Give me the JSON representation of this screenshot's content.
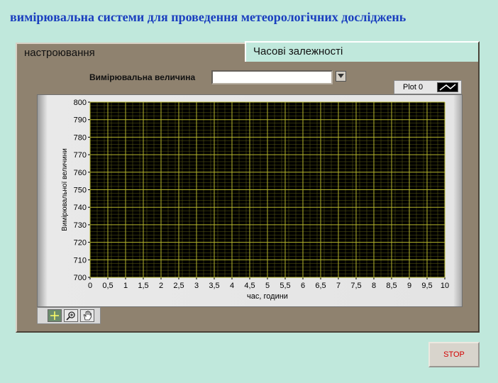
{
  "app": {
    "title": "вимірювальна системи для проведення метеорологічних досліджень"
  },
  "tabs": [
    {
      "label": "настроювання",
      "active": false
    },
    {
      "label": "Часові залежності",
      "active": true
    }
  ],
  "quantity": {
    "label": "Вимірювальна величина",
    "value": ""
  },
  "legend": {
    "plot_name": "Plot 0"
  },
  "stop_button": {
    "label": "STOP"
  },
  "colors": {
    "background": "#c0e8dc",
    "panel": "#8f826f",
    "plot_area": "#000000",
    "grid": "#b5b52c",
    "title_blue": "#1a3fbf",
    "stop_red": "#d40000"
  },
  "chart_data": {
    "type": "line",
    "xlabel": "час, години",
    "ylabel": "Вимірювальної величини",
    "xlim": [
      0,
      10
    ],
    "ylim": [
      700,
      800
    ],
    "x_ticks": [
      "0",
      "0,5",
      "1",
      "1,5",
      "2",
      "2,5",
      "3",
      "3,5",
      "4",
      "4,5",
      "5",
      "5,5",
      "6",
      "6,5",
      "7",
      "7,5",
      "8",
      "8,5",
      "9",
      "9,5",
      "10"
    ],
    "y_ticks": [
      "700",
      "710",
      "720",
      "730",
      "740",
      "750",
      "760",
      "770",
      "780",
      "790",
      "800"
    ],
    "grid": true,
    "series": [
      {
        "name": "Plot 0",
        "x": [],
        "y": []
      }
    ]
  },
  "toolbar": {
    "tools": [
      "cursor-icon",
      "zoom-icon",
      "hand-icon"
    ]
  }
}
